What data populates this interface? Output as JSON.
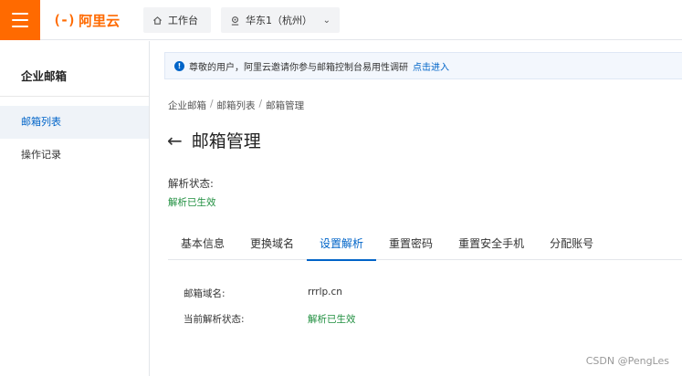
{
  "header": {
    "logo_mark": "(-)",
    "logo_text": "阿里云",
    "home_label": "工作台",
    "region_label": "华东1（杭州）"
  },
  "sidebar": {
    "title": "企业邮箱",
    "items": [
      {
        "label": "邮箱列表",
        "active": true
      },
      {
        "label": "操作记录",
        "active": false
      }
    ]
  },
  "notice": {
    "text": "尊敬的用户，阿里云邀请你参与邮箱控制台易用性调研",
    "link": "点击进入"
  },
  "breadcrumb": [
    "企业邮箱",
    "邮箱列表",
    "邮箱管理"
  ],
  "page": {
    "title": "邮箱管理",
    "status_label": "解析状态:",
    "status_value": "解析已生效"
  },
  "tabs": [
    {
      "label": "基本信息",
      "active": false
    },
    {
      "label": "更换域名",
      "active": false
    },
    {
      "label": "设置解析",
      "active": true
    },
    {
      "label": "重置密码",
      "active": false
    },
    {
      "label": "重置安全手机",
      "active": false
    },
    {
      "label": "分配账号",
      "active": false
    }
  ],
  "details": [
    {
      "label": "邮箱域名:",
      "value": "rrrlp.cn"
    },
    {
      "label": "当前解析状态:",
      "value": "解析已生效"
    }
  ],
  "watermark": "CSDN @PengLes",
  "colors": {
    "brand": "#ff6a00",
    "accent": "#0064c8",
    "success": "#1e8e3e"
  }
}
